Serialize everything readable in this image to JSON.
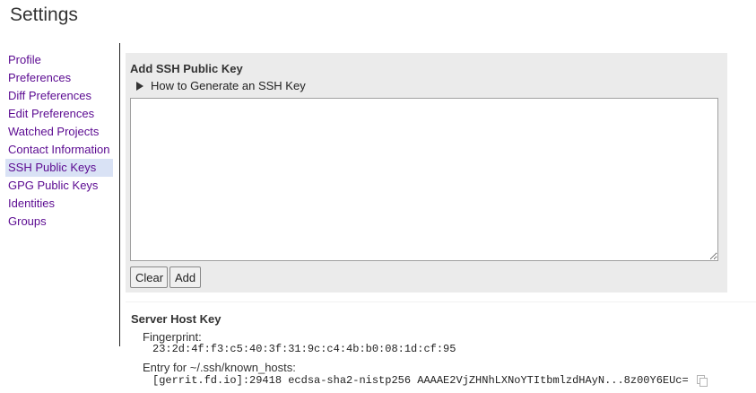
{
  "page": {
    "title": "Settings"
  },
  "sidebar": {
    "items": [
      {
        "label": "Profile"
      },
      {
        "label": "Preferences"
      },
      {
        "label": "Diff Preferences"
      },
      {
        "label": "Edit Preferences"
      },
      {
        "label": "Watched Projects"
      },
      {
        "label": "Contact Information"
      },
      {
        "label": "SSH Public Keys",
        "active": true
      },
      {
        "label": "GPG Public Keys"
      },
      {
        "label": "Identities"
      },
      {
        "label": "Groups"
      }
    ],
    "active_background": "#d9e2f5",
    "link_color": "#5b0a91"
  },
  "add_key": {
    "heading": "Add SSH Public Key",
    "howto_label": "How to Generate an SSH Key",
    "howto_icon": "triangle-right-icon",
    "textarea_value": "",
    "clear_label": "Clear",
    "add_label": "Add"
  },
  "server_host_key": {
    "heading": "Server Host Key",
    "fingerprint_label": "Fingerprint:",
    "fingerprint_value": "23:2d:4f:f3:c5:40:3f:31:9c:c4:4b:b0:08:1d:cf:95",
    "known_hosts_label": "Entry for ~/.ssh/known_hosts:",
    "known_hosts_value": "[gerrit.fd.io]:29418 ecdsa-sha2-nistp256 AAAAE2VjZHNhLXNoYTItbmlzdHAyN...8z00Y6EUc=",
    "copy_icon": "copy-icon"
  }
}
